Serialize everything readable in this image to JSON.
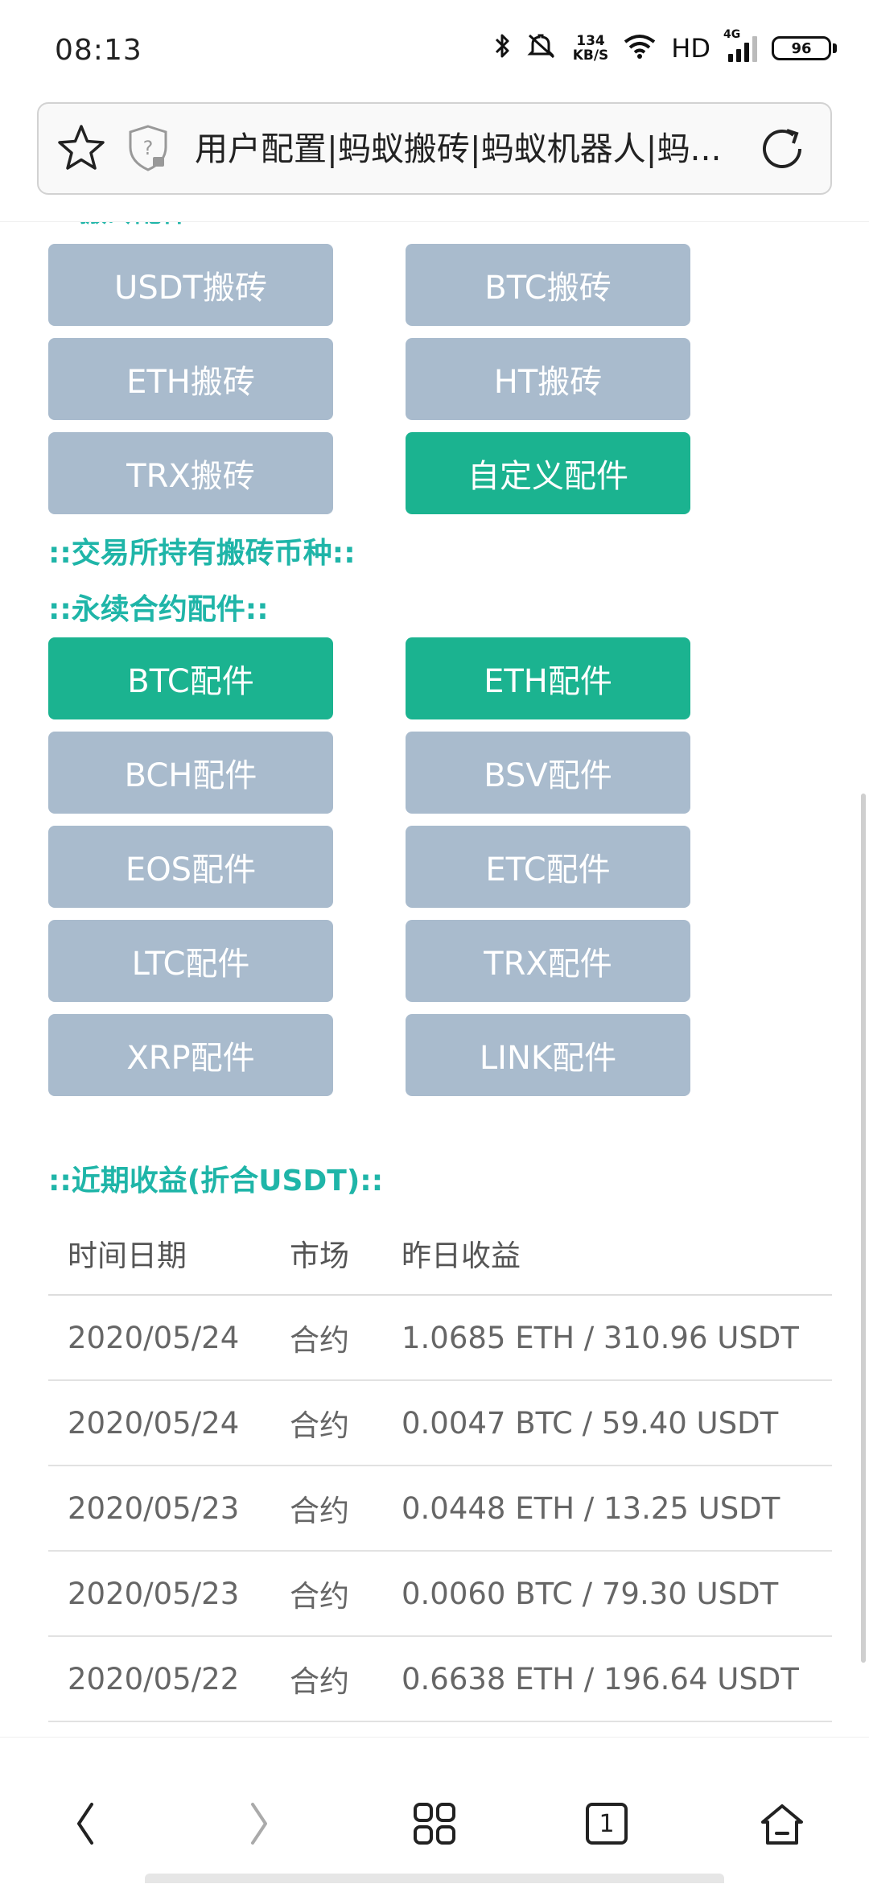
{
  "status": {
    "time": "08:13",
    "speed_value": "134",
    "speed_unit": "KB/S",
    "hd": "HD",
    "network": "4G",
    "battery": "96"
  },
  "address_bar": {
    "title": "用户配置|蚂蚁搬砖|蚂蚁机器人|蚂..."
  },
  "brick_buttons": [
    {
      "label": "USDT搬砖",
      "active": false
    },
    {
      "label": "BTC搬砖",
      "active": false
    },
    {
      "label": "ETH搬砖",
      "active": false
    },
    {
      "label": "HT搬砖",
      "active": false
    },
    {
      "label": "TRX搬砖",
      "active": false
    },
    {
      "label": "自定义配件",
      "active": true
    }
  ],
  "sections": {
    "exchange_coins": "::交易所持有搬砖币种::",
    "perpetual": "::永续合约配件::",
    "earnings": "::近期收益(折合USDT)::"
  },
  "perpetual_buttons": [
    {
      "label": "BTC配件",
      "active": true
    },
    {
      "label": "ETH配件",
      "active": true
    },
    {
      "label": "BCH配件",
      "active": false
    },
    {
      "label": "BSV配件",
      "active": false
    },
    {
      "label": "EOS配件",
      "active": false
    },
    {
      "label": "ETC配件",
      "active": false
    },
    {
      "label": "LTC配件",
      "active": false
    },
    {
      "label": "TRX配件",
      "active": false
    },
    {
      "label": "XRP配件",
      "active": false
    },
    {
      "label": "LINK配件",
      "active": false
    }
  ],
  "earnings_table": {
    "headers": [
      "时间日期",
      "市场",
      "昨日收益"
    ],
    "rows": [
      [
        "2020/05/24",
        "合约",
        "1.0685 ETH / 310.96 USDT"
      ],
      [
        "2020/05/24",
        "合约",
        "0.0047 BTC / 59.40 USDT"
      ],
      [
        "2020/05/23",
        "合约",
        "0.0448 ETH / 13.25 USDT"
      ],
      [
        "2020/05/23",
        "合约",
        "0.0060 BTC / 79.30 USDT"
      ],
      [
        "2020/05/22",
        "合约",
        "0.6638 ETH / 196.64 USDT"
      ]
    ]
  },
  "bottom_nav": {
    "tab_count": "1"
  },
  "colors": {
    "accent": "#1fb5a8",
    "active_button": "#1bb390",
    "inactive_button": "#a9bbcd"
  }
}
